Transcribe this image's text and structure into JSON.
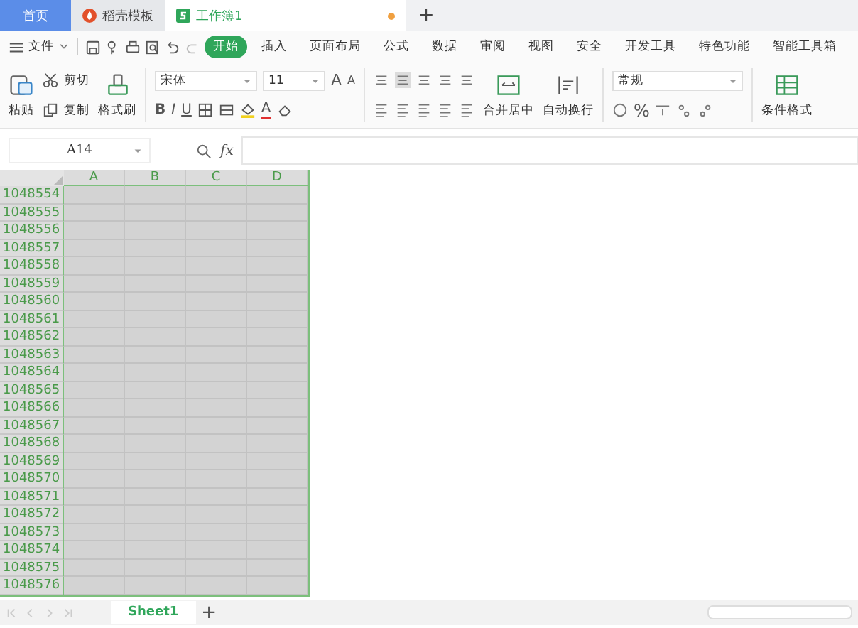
{
  "tabs": [
    {
      "label": "首页",
      "kind": "home",
      "selected": false
    },
    {
      "label": "稻壳模板",
      "kind": "template",
      "selected": false
    },
    {
      "label": "工作簿1",
      "kind": "sheet",
      "selected": true,
      "unsaved": true
    }
  ],
  "new_tab": "+",
  "menu": {
    "file": "文件",
    "items": [
      {
        "label": "开始",
        "selected": true
      },
      {
        "label": "插入",
        "selected": false
      },
      {
        "label": "页面布局",
        "selected": false
      },
      {
        "label": "公式",
        "selected": false
      },
      {
        "label": "数据",
        "selected": false
      },
      {
        "label": "审阅",
        "selected": false
      },
      {
        "label": "视图",
        "selected": false
      },
      {
        "label": "安全",
        "selected": false
      },
      {
        "label": "开发工具",
        "selected": false
      },
      {
        "label": "特色功能",
        "selected": false
      },
      {
        "label": "智能工具箱",
        "selected": false
      }
    ]
  },
  "toolbar": {
    "paste": "粘贴",
    "cut": "剪切",
    "copy": "复制",
    "format_painter": "格式刷",
    "font": "宋体",
    "font_size": "11",
    "grow": "A",
    "shrink": "A",
    "bold": "B",
    "italic": "I",
    "underline": "U",
    "font_color": "A",
    "merge": "合并居中",
    "wrap": "自动换行",
    "number_format": "常规",
    "percent": "%",
    "conditional": "条件格式"
  },
  "formula_bar": {
    "name_box": "A14",
    "fx": "fx"
  },
  "columns": [
    "A",
    "B",
    "C",
    "D"
  ],
  "rows": [
    "1048554",
    "1048555",
    "1048556",
    "1048557",
    "1048558",
    "1048559",
    "1048560",
    "1048561",
    "1048562",
    "1048563",
    "1048564",
    "1048565",
    "1048566",
    "1048567",
    "1048568",
    "1048569",
    "1048570",
    "1048571",
    "1048572",
    "1048573",
    "1048574",
    "1048575",
    "1048576"
  ],
  "sheets": [
    {
      "label": "Sheet1",
      "selected": true
    }
  ],
  "add_sheet": "+"
}
